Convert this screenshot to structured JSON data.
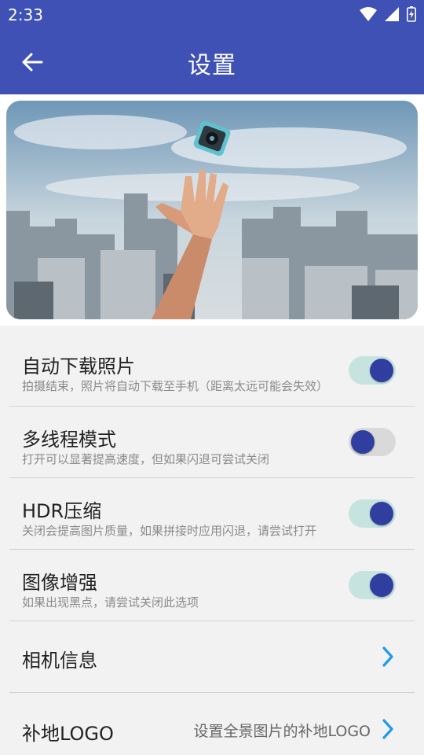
{
  "status": {
    "time": "2:33"
  },
  "header": {
    "title": "设置"
  },
  "settings": [
    {
      "title": "自动下载照片",
      "desc": "拍摄结束，照片将自动下载至手机（距离太远可能会失效）",
      "on": true
    },
    {
      "title": "多线程模式",
      "desc": "打开可以显著提高速度，但如果闪退可尝试关闭",
      "on": false
    },
    {
      "title": "HDR压缩",
      "desc": "关闭会提高图片质量，如果拼接时应用闪退，请尝试打开",
      "on": true
    },
    {
      "title": "图像增强",
      "desc": "如果出现黑点，请尝试关闭此选项",
      "on": true
    }
  ],
  "links": [
    {
      "title": "相机信息",
      "value": ""
    },
    {
      "title": "补地LOGO",
      "value": "设置全景图片的补地LOGO"
    }
  ],
  "colors": {
    "primary": "#3f51b5",
    "thumb": "#303f9f",
    "track_on": "#c7e3e0",
    "track_off": "#d9d9d9",
    "accent": "#1e9be9"
  }
}
